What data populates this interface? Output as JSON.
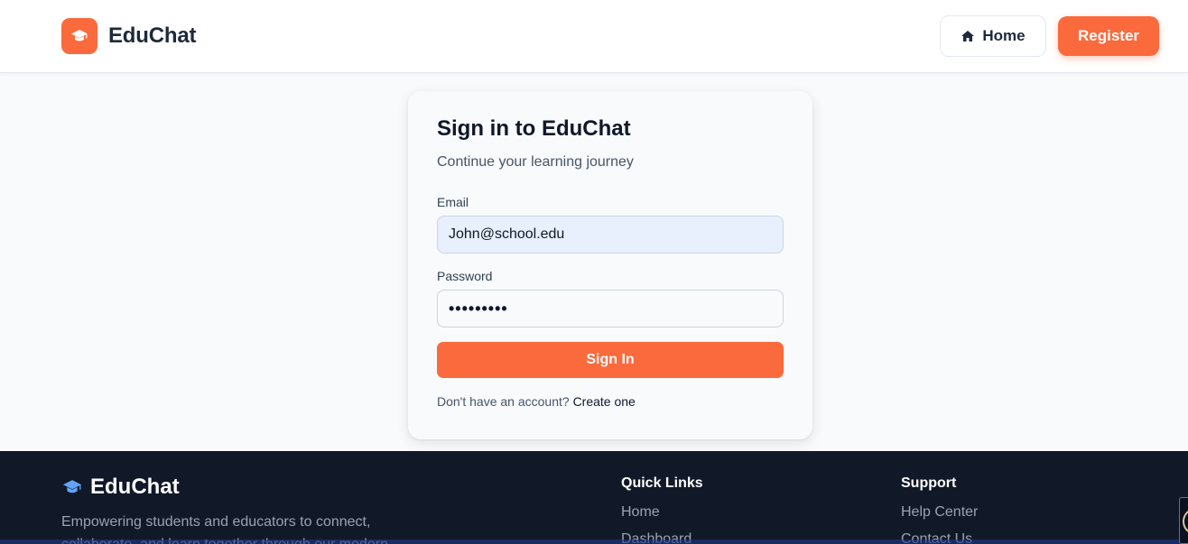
{
  "header": {
    "brand_name": "EduChat",
    "home_label": "Home",
    "register_label": "Register"
  },
  "login": {
    "title": "Sign in to EduChat",
    "subtitle": "Continue your learning journey",
    "email_label": "Email",
    "email_value": "John@school.edu",
    "password_label": "Password",
    "password_value": "•••••••••",
    "submit_label": "Sign In",
    "no_account_text": "Don't have an account?",
    "create_link": "Create one"
  },
  "footer": {
    "brand_name": "EduChat",
    "description": "Empowering students and educators to connect, collaborate, and learn together through our modern",
    "quick_links": {
      "title": "Quick Links",
      "items": [
        "Home",
        "Dashboard"
      ]
    },
    "support": {
      "title": "Support",
      "items": [
        "Help Center",
        "Contact Us"
      ]
    }
  },
  "icons": {
    "brand": "graduation-cap-icon",
    "home": "home-icon"
  },
  "colors": {
    "accent": "#fb6a3c",
    "footer_bg": "#111827",
    "footer_icon": "#60a5fa"
  }
}
